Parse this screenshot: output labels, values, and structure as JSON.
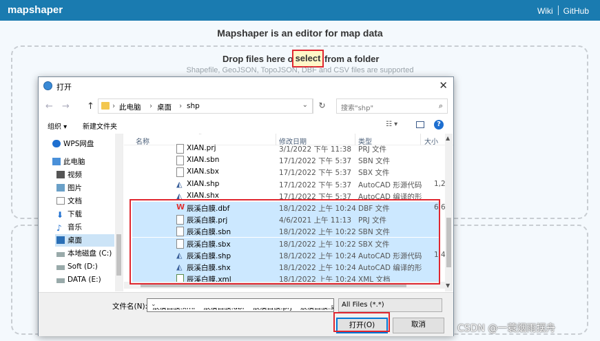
{
  "app": {
    "logo": "mapshaper",
    "links": [
      "Wiki",
      "GitHub"
    ],
    "headline": "Mapshaper is an editor for map data",
    "drop_text_before": "Drop files here or",
    "select_label": "select",
    "drop_text_after": "from a folder",
    "supported": "Shapefile, GeoJSON, TopoJSON, DBF and CSV files are supported"
  },
  "dialog": {
    "title": "打开",
    "breadcrumb": [
      "此电脑",
      "桌面",
      "shp"
    ],
    "search_placeholder": "搜索\"shp\"",
    "organize": "组织 ▾",
    "new_folder": "新建文件夹",
    "nav_items": [
      {
        "label": "WPS网盘",
        "icon": "cloud-icon"
      },
      {
        "label": "此电脑",
        "icon": "computer-icon"
      },
      {
        "label": "视频",
        "icon": "video-icon"
      },
      {
        "label": "图片",
        "icon": "picture-icon"
      },
      {
        "label": "文档",
        "icon": "document-icon"
      },
      {
        "label": "下载",
        "icon": "download-icon"
      },
      {
        "label": "音乐",
        "icon": "music-icon"
      },
      {
        "label": "桌面",
        "icon": "desktop-icon"
      },
      {
        "label": "本地磁盘 (C:)",
        "icon": "drive-icon"
      },
      {
        "label": "Soft (D:)",
        "icon": "drive-icon"
      },
      {
        "label": "DATA (E:)",
        "icon": "drive-icon"
      }
    ],
    "columns": [
      "名称",
      "修改日期",
      "类型",
      "大小"
    ],
    "files": [
      {
        "name": "XIAN.prj",
        "date": "3/1/2022 下午 11:38",
        "type": "PRJ 文件",
        "size": "",
        "icon": "file",
        "selected": false
      },
      {
        "name": "XIAN.sbn",
        "date": "17/1/2022 下午 5:37",
        "type": "SBN 文件",
        "size": "",
        "icon": "file",
        "selected": false
      },
      {
        "name": "XIAN.sbx",
        "date": "17/1/2022 下午 5:37",
        "type": "SBX 文件",
        "size": "",
        "icon": "file",
        "selected": false
      },
      {
        "name": "XIAN.shp",
        "date": "17/1/2022 下午 5:37",
        "type": "AutoCAD 形源代码",
        "size": "1,2",
        "icon": "cad",
        "selected": false
      },
      {
        "name": "XIAN.shx",
        "date": "17/1/2022 下午 5:37",
        "type": "AutoCAD 编译的形",
        "size": "",
        "icon": "cad",
        "selected": false
      },
      {
        "name": "辰溪白膜.dbf",
        "date": "18/1/2022 上午 10:24",
        "type": "DBF 文件",
        "size": "6,6",
        "icon": "wps",
        "selected": true
      },
      {
        "name": "辰溪白膜.prj",
        "date": "4/6/2021 上午 11:13",
        "type": "PRJ 文件",
        "size": "",
        "icon": "file",
        "selected": true
      },
      {
        "name": "辰溪白膜.sbn",
        "date": "18/1/2022 上午 10:22",
        "type": "SBN 文件",
        "size": "",
        "icon": "file",
        "selected": true
      },
      {
        "name": "辰溪白膜.sbx",
        "date": "18/1/2022 上午 10:22",
        "type": "SBX 文件",
        "size": "",
        "icon": "file",
        "selected": true
      },
      {
        "name": "辰溪白膜.shp",
        "date": "18/1/2022 上午 10:24",
        "type": "AutoCAD 形源代码",
        "size": "1,4",
        "icon": "cad",
        "selected": true
      },
      {
        "name": "辰溪白膜.shx",
        "date": "18/1/2022 上午 10:24",
        "type": "AutoCAD 编译的形",
        "size": "",
        "icon": "cad",
        "selected": true
      },
      {
        "name": "辰溪白膜.xml",
        "date": "18/1/2022 上午 10:24",
        "type": "XML 文档",
        "size": "",
        "icon": "xml",
        "selected": true
      }
    ],
    "filename_label": "文件名(N):",
    "filename_value": "\"辰溪白膜.xml\" \"辰溪白膜.dbf\" \"辰溪白膜.prj\" \"辰溪白膜.s",
    "filetype_value": "All Files (*.*)",
    "open_label": "打开(O)",
    "cancel_label": "取消"
  },
  "watermark": "CSDN @一蓑烟雨摆舟",
  "colors": {
    "brand": "#1a7bb0",
    "highlight_outline": "#e0262f",
    "selection": "#cce8ff"
  }
}
